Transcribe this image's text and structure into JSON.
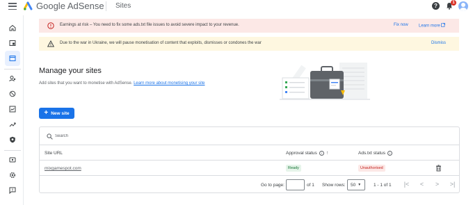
{
  "app": {
    "brand_name": "Google AdSense",
    "page_title": "Sites",
    "notification_count": "1",
    "help_glyph": "?"
  },
  "banners": {
    "error": {
      "text": "Earnings at risk – You need to fix some ads.txt file issues to avoid severe impact to your revenue.",
      "fix_label": "Fix now",
      "learn_label": "Learn more"
    },
    "warning": {
      "text": "Due to the war in Ukraine, we will pause monetisation of content that exploits, dismisses or condones the war",
      "dismiss_label": "Dismiss"
    }
  },
  "main": {
    "heading": "Manage your sites",
    "subtext": "Add sites that you want to monetise with AdSense.",
    "subtext_link": "Learn more about monetising your site",
    "new_site_label": "New site"
  },
  "table": {
    "search_placeholder": "Search",
    "columns": {
      "site_url": "Site URL",
      "approval_status": "Approval status",
      "ads_txt_status": "Ads.txt status"
    },
    "rows": [
      {
        "site": "mixgamespot.com",
        "approval": "Ready",
        "ads_txt": "Unauthorised"
      }
    ],
    "pagination": {
      "goto_label": "Go to page:",
      "of_pages": "of 1",
      "rows_label": "Show rows:",
      "rows_value": "50",
      "range": "1 - 1 of 1"
    }
  },
  "colors": {
    "accent": "#1a73e8",
    "error_bg": "#fce8e6",
    "warning_bg": "#fef7e0",
    "ready_chip": "#e6f4ea",
    "unauthorised_chip": "#fce8e6"
  },
  "icons": {
    "sidebar": [
      "home-icon",
      "ads-icon",
      "sites-icon",
      "privacy-messaging-icon",
      "blocking-controls-icon",
      "reports-icon",
      "optimisation-icon",
      "policy-center-icon",
      "payments-icon",
      "account-icon",
      "feedback-icon"
    ]
  }
}
